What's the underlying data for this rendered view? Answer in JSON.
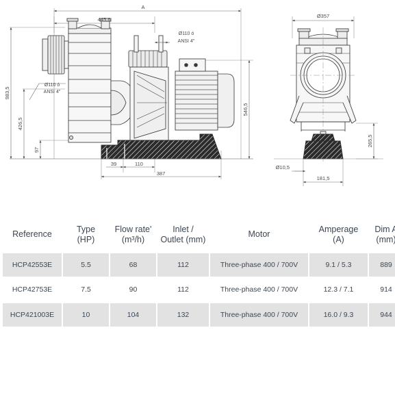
{
  "drawing": {
    "title_label": "A",
    "side_view": {
      "overall_width_label": "A",
      "dim_445_6": "445,6",
      "dim_983_5": "983,5",
      "dim_426_5": "426,5",
      "dim_97": "97",
      "dim_546_5": "546,5",
      "dim_39": "39",
      "dim_110": "110",
      "dim_387": "387",
      "inlet_callout_line1": "Ø110 ó",
      "inlet_callout_line2": "ANSI 4\"",
      "outlet_callout_line1": "Ø110 ó",
      "outlet_callout_line2": "ANSI 4\""
    },
    "front_view": {
      "dim_diameter_357": "Ø357",
      "dim_265_5": "265,5",
      "dim_181_5": "181,5",
      "dim_hole_10_5": "Ø10,5"
    }
  },
  "table": {
    "headers": [
      {
        "line1": "Reference",
        "line2": ""
      },
      {
        "line1": "Type",
        "line2": "(HP)"
      },
      {
        "line1": "Flow rate'",
        "line2": "(m³/h)"
      },
      {
        "line1": "Inlet /",
        "line2": "Outlet (mm)"
      },
      {
        "line1": "Motor",
        "line2": ""
      },
      {
        "line1": "Amperage",
        "line2": "(A)"
      },
      {
        "line1": "Dim A",
        "line2": "(mm)"
      }
    ],
    "rows": [
      {
        "reference": "HCP42553E",
        "type_hp": "5.5",
        "flow_rate": "68",
        "inlet_outlet": "112",
        "motor": "Three-phase 400 / 700V",
        "amperage": "9.1 / 5.3",
        "dim_a": "889"
      },
      {
        "reference": "HCP42753E",
        "type_hp": "7.5",
        "flow_rate": "90",
        "inlet_outlet": "112",
        "motor": "Three-phase 400 / 700V",
        "amperage": "12.3 / 7.1",
        "dim_a": "914"
      },
      {
        "reference": "HCP421003E",
        "type_hp": "10",
        "flow_rate": "104",
        "inlet_outlet": "132",
        "motor": "Three-phase 400 / 700V",
        "amperage": "16.0 / 9.3",
        "dim_a": "944"
      }
    ]
  },
  "colors": {
    "text": "#3c4652",
    "row_shade": "#e2e2e2",
    "line": "#4a4a4a",
    "part_fill": "#f2f2f2",
    "hatch": "#2b2b2b"
  }
}
